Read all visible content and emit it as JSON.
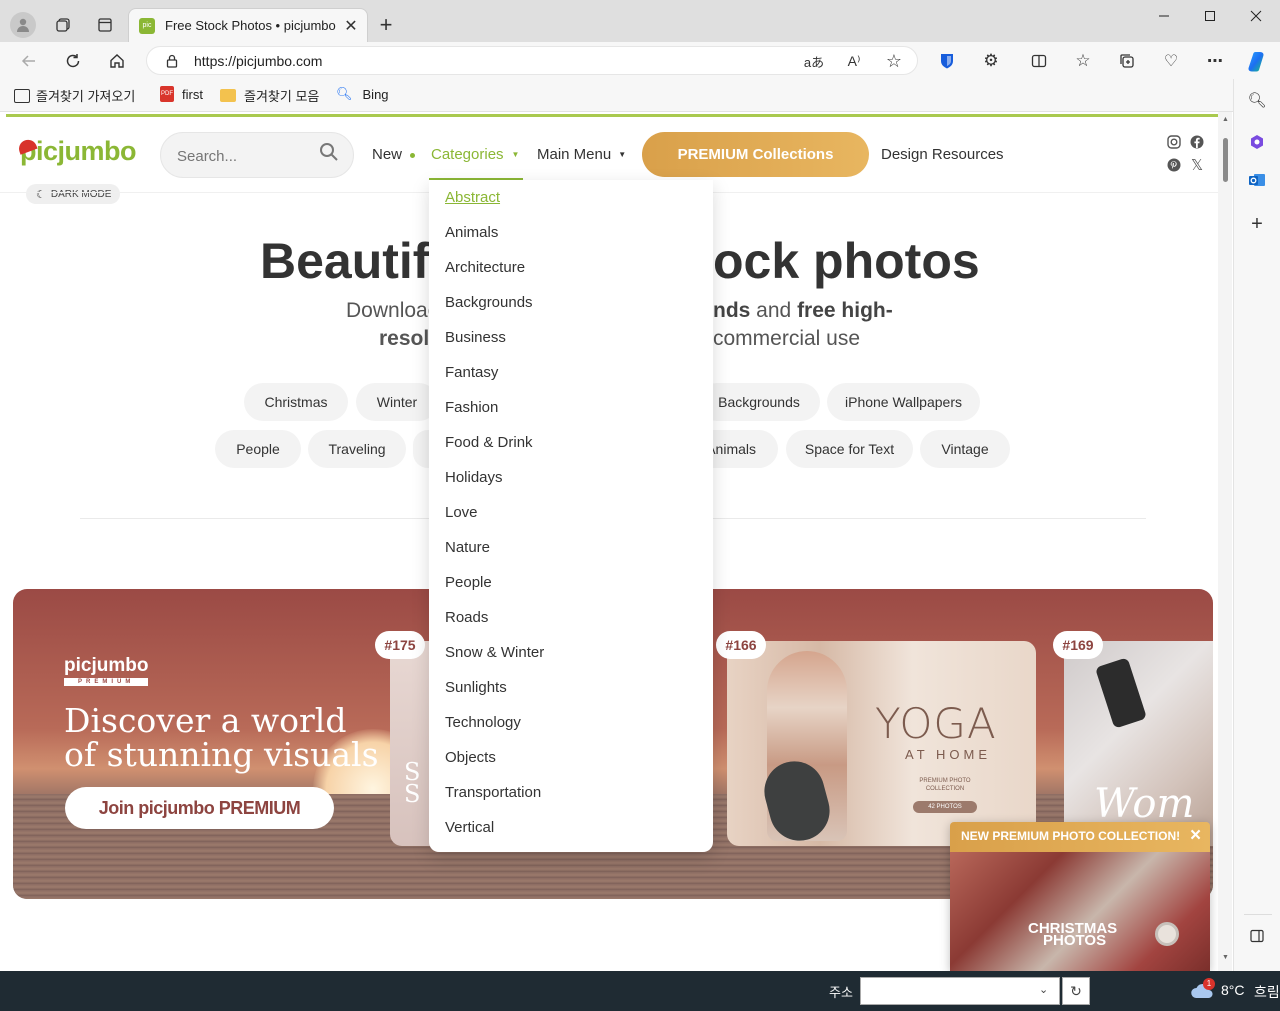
{
  "browser": {
    "tab_title": "Free Stock Photos • picjumbo",
    "tab_favicon_text": "pic",
    "url": "https://picjumbo.com",
    "favorites": [
      {
        "label": "즐겨찾기 가져오기",
        "icon": "import-icon"
      },
      {
        "label": "first",
        "icon": "pdf-icon"
      },
      {
        "label": "즐겨찾기 모음",
        "icon": "folder-icon"
      },
      {
        "label": "Bing",
        "icon": "search-icon"
      }
    ],
    "window_controls": [
      "minimize",
      "maximize",
      "close"
    ],
    "colors": {
      "accent": "#2b6cd4"
    }
  },
  "site": {
    "logo": "picjumbo",
    "dark_mode_label": "DARK MODE",
    "search_placeholder": "Search...",
    "nav": {
      "new": "New",
      "categories": "Categories",
      "main_menu": "Main Menu",
      "premium": "PREMIUM Collections",
      "design": "Design Resources"
    },
    "hero": {
      "title_left": "Beautif",
      "title_right": "ock photos",
      "sub1_left": "Downloac",
      "sub1_right_bold": "nds",
      "sub1_right_mid": " and ",
      "sub1_right_bold2": "free high-",
      "sub2_left": "resol",
      "sub2_right": "commercial use"
    },
    "chips_row1": [
      "Christmas",
      "Winter",
      "Backgrounds",
      "iPhone Wallpapers"
    ],
    "chips_row2": [
      "People",
      "Traveling",
      "Animals",
      "Space for Text",
      "Vintage"
    ],
    "categories_menu": [
      "Abstract",
      "Animals",
      "Architecture",
      "Backgrounds",
      "Business",
      "Fantasy",
      "Fashion",
      "Food & Drink",
      "Holidays",
      "Love",
      "Nature",
      "People",
      "Roads",
      "Snow & Winter",
      "Sunlights",
      "Technology",
      "Objects",
      "Transportation",
      "Vertical"
    ],
    "banner": {
      "brand": "picjumbo",
      "brand_sub": "PREMIUM",
      "headline1": "Discover a world",
      "headline2": "of stunning visuals",
      "cta": "Join picjumbo PREMIUM",
      "badges": [
        "#175",
        "#166",
        "#169"
      ],
      "yoga_title": "YOGA",
      "yoga_sub": "AT HOME",
      "yoga_small": "PREMIUM PHOTO COLLECTION",
      "yoga_count": "42 PHOTOS",
      "card1_text": "S\nS",
      "card3_text": "Wom"
    },
    "popup": {
      "title": "NEW PREMIUM PHOTO COLLECTION!",
      "close": "×",
      "image_text1": "CHRISTMAS",
      "image_text2": "PHOTOS"
    },
    "colors": {
      "green": "#8bb735",
      "gold": "#dfa84f",
      "banner": "#a95a4e"
    }
  },
  "taskbar": {
    "address_label": "주소",
    "weather_temp": "8°C",
    "weather_desc": "흐림",
    "notification_count": "1"
  }
}
